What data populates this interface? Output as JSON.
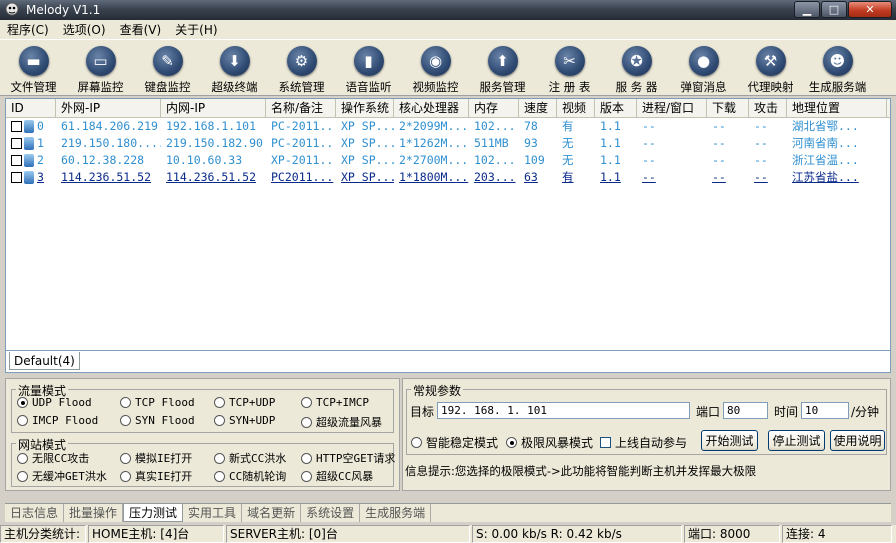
{
  "window": {
    "title": "Melody V1.1",
    "minimize": "▁",
    "maximize": "□",
    "close": "✕"
  },
  "menu": [
    "程序(C)",
    "选项(O)",
    "查看(V)",
    "关于(H)"
  ],
  "toolbar": [
    {
      "label": "文件管理",
      "icon": "folder-icon",
      "glyph": "▬"
    },
    {
      "label": "屏幕监控",
      "icon": "monitor-icon",
      "glyph": "▭"
    },
    {
      "label": "键盘监控",
      "icon": "pencil-icon",
      "glyph": "✎"
    },
    {
      "label": "超级终端",
      "icon": "download-icon",
      "glyph": "⬇"
    },
    {
      "label": "系统管理",
      "icon": "gear-icon",
      "glyph": "⚙"
    },
    {
      "label": "语音监听",
      "icon": "equalizer-icon",
      "glyph": "▮"
    },
    {
      "label": "视频监控",
      "icon": "camera-icon",
      "glyph": "◉"
    },
    {
      "label": "服务管理",
      "icon": "upload-icon",
      "glyph": "⬆"
    },
    {
      "label": "注 册 表",
      "icon": "wrench-icon",
      "glyph": "✂"
    },
    {
      "label": "服 务 器",
      "icon": "medal-icon",
      "glyph": "✪"
    },
    {
      "label": "弹窗消息",
      "icon": "chat-bubble-icon",
      "glyph": "●"
    },
    {
      "label": "代理映射",
      "icon": "tools-icon",
      "glyph": "⚒"
    },
    {
      "label": "生成服务端",
      "icon": "users-icon",
      "glyph": "☻"
    }
  ],
  "grid": {
    "columns": [
      "ID",
      "外网-IP",
      "内网-IP",
      "名称/备注",
      "操作系统",
      "核心处理器",
      "内存",
      "速度",
      "视频",
      "版本",
      "进程/窗口",
      "下载",
      "攻击",
      "地理位置"
    ],
    "rows": [
      {
        "id": "0",
        "wan": "61.184.206.219",
        "lan": "192.168.1.101",
        "name": "PC-2011...",
        "os": "XP SP...",
        "cpu": "2*2099M...",
        "mem": "102...",
        "speed": "78",
        "video": "有",
        "ver": "1.1",
        "proc": "--",
        "dl": "--",
        "atk": "--",
        "geo": "湖北省鄂..."
      },
      {
        "id": "1",
        "wan": "219.150.180....",
        "lan": "219.150.182.90",
        "name": "PC-2011...",
        "os": "XP SP...",
        "cpu": "1*1262M...",
        "mem": "511MB",
        "speed": "93",
        "video": "无",
        "ver": "1.1",
        "proc": "--",
        "dl": "--",
        "atk": "--",
        "geo": "河南省南..."
      },
      {
        "id": "2",
        "wan": "60.12.38.228",
        "lan": "10.10.60.33",
        "name": "XP-2011...",
        "os": "XP SP...",
        "cpu": "2*2700M...",
        "mem": "102...",
        "speed": "109",
        "video": "无",
        "ver": "1.1",
        "proc": "--",
        "dl": "--",
        "atk": "--",
        "geo": "浙江省温..."
      },
      {
        "id": "3",
        "wan": "114.236.51.52",
        "lan": "114.236.51.52",
        "name": "PC2011...",
        "os": "XP SP...",
        "cpu": "1*1800M...",
        "mem": "203...",
        "speed": "63",
        "video": "有",
        "ver": "1.1",
        "proc": "--",
        "dl": "--",
        "atk": "--",
        "geo": "江苏省盐..."
      }
    ]
  },
  "group_tab": "Default(4)",
  "flow": {
    "title": "流量模式",
    "opts": [
      "UDP Flood",
      "TCP Flood",
      "TCP+UDP",
      "TCP+IMCP",
      "IMCP Flood",
      "SYN Flood",
      "SYN+UDP",
      "超级流量风暴"
    ]
  },
  "web": {
    "title": "网站模式",
    "opts": [
      "无限CC攻击",
      "模拟IE打开",
      "新式CC洪水",
      "HTTP空GET请求",
      "无缓冲GET洪水",
      "真实IE打开",
      "CC随机轮询",
      "超级CC风暴"
    ]
  },
  "params": {
    "title": "常规参数",
    "target_label": "目标",
    "target": "192. 168. 1. 101",
    "port_label": "端口",
    "port": "80",
    "time_label": "时间",
    "time": "10",
    "unit": "/分钟",
    "mode_a": "智能稳定模式",
    "mode_b": "极限风暴模式",
    "auto": "上线自动参与",
    "start": "开始测试",
    "stop": "停止测试",
    "help": "使用说明",
    "info": "信息提示:您选择的极限模式->此功能将智能判断主机并发挥最大极限"
  },
  "bottom_tabs": [
    "日志信息",
    "批量操作",
    "压力测试",
    "实用工具",
    "域名更新",
    "系统设置",
    "生成服务端"
  ],
  "status": {
    "stats": "主机分类统计:",
    "home": "HOME主机: [4]台",
    "server": "SERVER主机: [0]台",
    "speed": "S: 0.00 kb/s R: 0.42 kb/s",
    "port": "端口: 8000",
    "conn": "连接: 4"
  }
}
